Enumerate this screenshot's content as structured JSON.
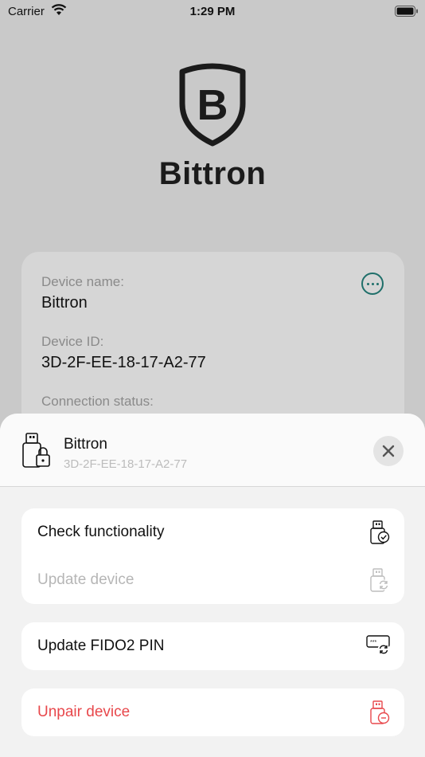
{
  "status_bar": {
    "carrier": "Carrier",
    "time": "1:29 PM"
  },
  "brand": {
    "logo_letter": "B",
    "name": "Bittron"
  },
  "device_card": {
    "name_label": "Device name:",
    "name_value": "Bittron",
    "id_label": "Device ID:",
    "id_value": "3D-2F-EE-18-17-A2-77",
    "connection_label": "Connection status:"
  },
  "sheet": {
    "title": "Bittron",
    "subtitle": "3D-2F-EE-18-17-A2-77",
    "actions": {
      "check_functionality": "Check functionality",
      "update_device": "Update device",
      "update_fido2_pin": "Update FIDO2 PIN",
      "unpair_device": "Unpair device"
    }
  },
  "colors": {
    "accent": "#1f6f6a",
    "danger": "#e8484c",
    "disabled": "#b6b6b6"
  }
}
